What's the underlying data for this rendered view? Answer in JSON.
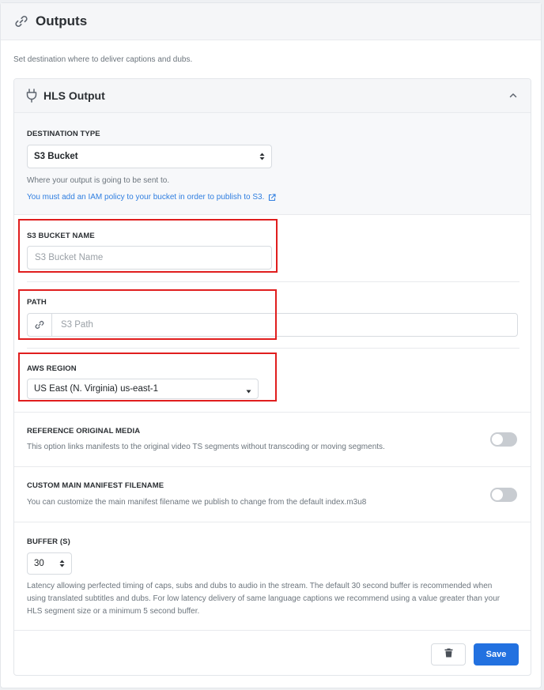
{
  "card": {
    "title": "Outputs",
    "description": "Set destination where to deliver captions and dubs."
  },
  "panel": {
    "title": "HLS Output"
  },
  "destination": {
    "label": "DESTINATION TYPE",
    "selected": "S3 Bucket",
    "help": "Where your output is going to be sent to.",
    "iam_link": "You must add an IAM policy to your bucket in order to publish to S3."
  },
  "bucket": {
    "label": "S3 BUCKET NAME",
    "placeholder": "S3 Bucket Name"
  },
  "path": {
    "label": "PATH",
    "placeholder": "S3 Path"
  },
  "region": {
    "label": "AWS REGION",
    "selected": "US East (N. Virginia) us-east-1"
  },
  "reference": {
    "label": "REFERENCE ORIGINAL MEDIA",
    "help": "This option links manifests to the original video TS segments without transcoding or moving segments.",
    "enabled": false
  },
  "manifest": {
    "label": "CUSTOM MAIN MANIFEST FILENAME",
    "help": "You can customize the main manifest filename we publish to change from the default index.m3u8",
    "enabled": false
  },
  "buffer": {
    "label": "BUFFER (S)",
    "selected": "30",
    "help": "Latency allowing perfected timing of caps, subs and dubs to audio in the stream. The default 30 second buffer is recommended when using translated subtitles and dubs. For low latency delivery of same language captions we recommend using a value greater than your HLS segment size or a minimum 5 second buffer."
  },
  "actions": {
    "save_label": "Save"
  },
  "colors": {
    "accent": "#2271e0",
    "link": "#2f7ee0",
    "highlight": "#e01e1e"
  },
  "icons": {
    "header": "link-icon",
    "panel": "plug-icon",
    "collapse": "chevron-up-icon",
    "external": "external-link-icon",
    "path_prefix": "link-icon",
    "delete": "trash-icon"
  }
}
